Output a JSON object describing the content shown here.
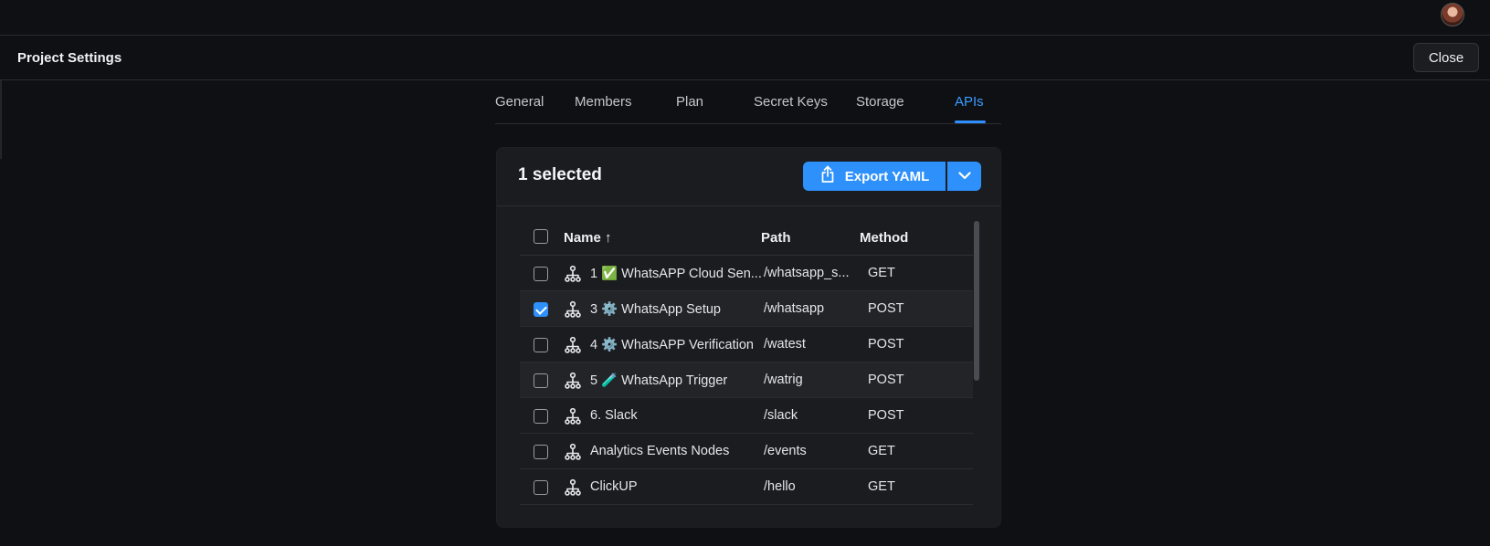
{
  "header": {
    "title": "Project Settings",
    "close_label": "Close"
  },
  "tabs": [
    {
      "label": "General"
    },
    {
      "label": "Members"
    },
    {
      "label": "Plan"
    },
    {
      "label": "Secret Keys"
    },
    {
      "label": "Storage"
    },
    {
      "label": "APIs"
    }
  ],
  "active_tab": "APIs",
  "card": {
    "selected_label": "1 selected",
    "export_label": "Export YAML"
  },
  "table": {
    "columns": {
      "name": "Name ↑",
      "path": "Path",
      "method": "Method"
    },
    "rows": [
      {
        "name": "1 ✅ WhatsAPP Cloud Sen...",
        "path": "/whatsapp_s...",
        "method": "GET",
        "checked": false
      },
      {
        "name": "3 ⚙️ WhatsApp Setup",
        "path": "/whatsapp",
        "method": "POST",
        "checked": true
      },
      {
        "name": "4 ⚙️ WhatsAPP Verification",
        "path": "/watest",
        "method": "POST",
        "checked": false
      },
      {
        "name": "5 🧪 WhatsApp Trigger",
        "path": "/watrig",
        "method": "POST",
        "checked": false
      },
      {
        "name": "6. Slack",
        "path": "/slack",
        "method": "POST",
        "checked": false
      },
      {
        "name": "Analytics Events Nodes",
        "path": "/events",
        "method": "GET",
        "checked": false
      },
      {
        "name": "ClickUP",
        "path": "/hello",
        "method": "GET",
        "checked": false
      }
    ]
  },
  "colors": {
    "accent": "#2e90fa",
    "background": "#0f1014",
    "card": "#1b1c20"
  },
  "icons": {
    "row_icon": "api-flow-icon",
    "export_icon": "share-upload-icon",
    "caret_icon": "chevron-down-icon"
  }
}
